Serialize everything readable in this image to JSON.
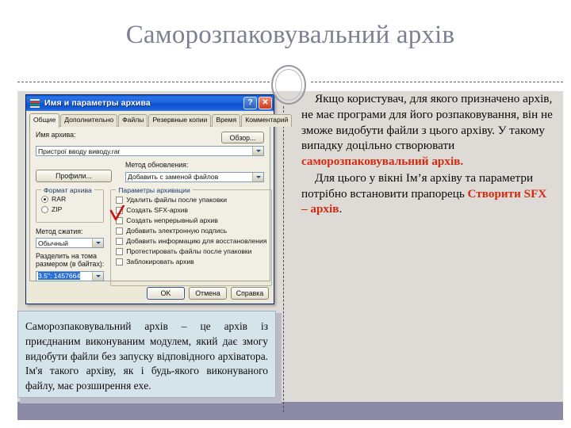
{
  "slide": {
    "title": "Саморозпаковувальний архів"
  },
  "body": {
    "paragraph1_part1": "Якщо користувач, для якого призначено архів, не має програми для його розпаковування, він не зможе видобути файли з цього архіву. У такому випадку доцільно створювати ",
    "paragraph1_highlight": "саморозпаковувальний  архів.",
    "paragraph2_part1": "Для цього у вікні Ім’я архіву та параметри потрібно встановити прапорець ",
    "paragraph2_highlight": "Створити SFX – архів",
    "paragraph2_part2": "."
  },
  "caption": {
    "text": "Саморозпаковувальний архів – це архів із приєднаним виконуваним модулем, який дає змогу видобути файли без запуску відповідного архіватора. Ім'я такого архіву, як і будь-якого виконуваного файлу, має розширення exe."
  },
  "dialog": {
    "title": "Имя и параметры архива",
    "help_button": "?",
    "close_button": "✕",
    "tabs": [
      {
        "label": "Общие",
        "active": true
      },
      {
        "label": "Дополнительно",
        "active": false
      },
      {
        "label": "Файлы",
        "active": false
      },
      {
        "label": "Резервные копии",
        "active": false
      },
      {
        "label": "Время",
        "active": false
      },
      {
        "label": "Комментарий",
        "active": false
      }
    ],
    "archive_name_label": "Имя архива:",
    "archive_name_value": "Пристрої вводу виводу.rar",
    "browse_button": "Обзор...",
    "profiles_button": "Профили...",
    "update_method_label": "Метод обновления:",
    "update_method_value": "Добавить с заменой файлов",
    "format_group_title": "Формат архива",
    "format_options": [
      {
        "label": "RAR",
        "selected": true
      },
      {
        "label": "ZIP",
        "selected": false
      }
    ],
    "compression_label": "Метод сжатия:",
    "compression_value": "Обычный",
    "split_label_line1": "Разделить на тома",
    "split_label_line2": "размером (в байтах):",
    "split_value": "3.5\":    1457664",
    "options_group_title": "Параметры архивации",
    "options": [
      {
        "label": "Удалить файлы после упаковки",
        "checked": false
      },
      {
        "label": "Создать SFX-архив",
        "checked": false,
        "annotated": true
      },
      {
        "label": "Создать непрерывный архив",
        "checked": false
      },
      {
        "label": "Добавить электронную подпись",
        "checked": false
      },
      {
        "label": "Добавить информацию для восстановления",
        "checked": false
      },
      {
        "label": "Протестировать файлы после упаковки",
        "checked": false
      },
      {
        "label": "Заблокировать архив",
        "checked": false
      }
    ],
    "ok_button": "OK",
    "cancel_button": "Отмена",
    "help_action_button": "Справка"
  },
  "colors": {
    "title": "#7d7f95",
    "accent_red": "#d42a10",
    "titlebar_blue": "#1e66dd",
    "caption_bg": "#d5e3ea",
    "footer_band": "#8b8ba5",
    "page_bg": "#dedad6"
  }
}
